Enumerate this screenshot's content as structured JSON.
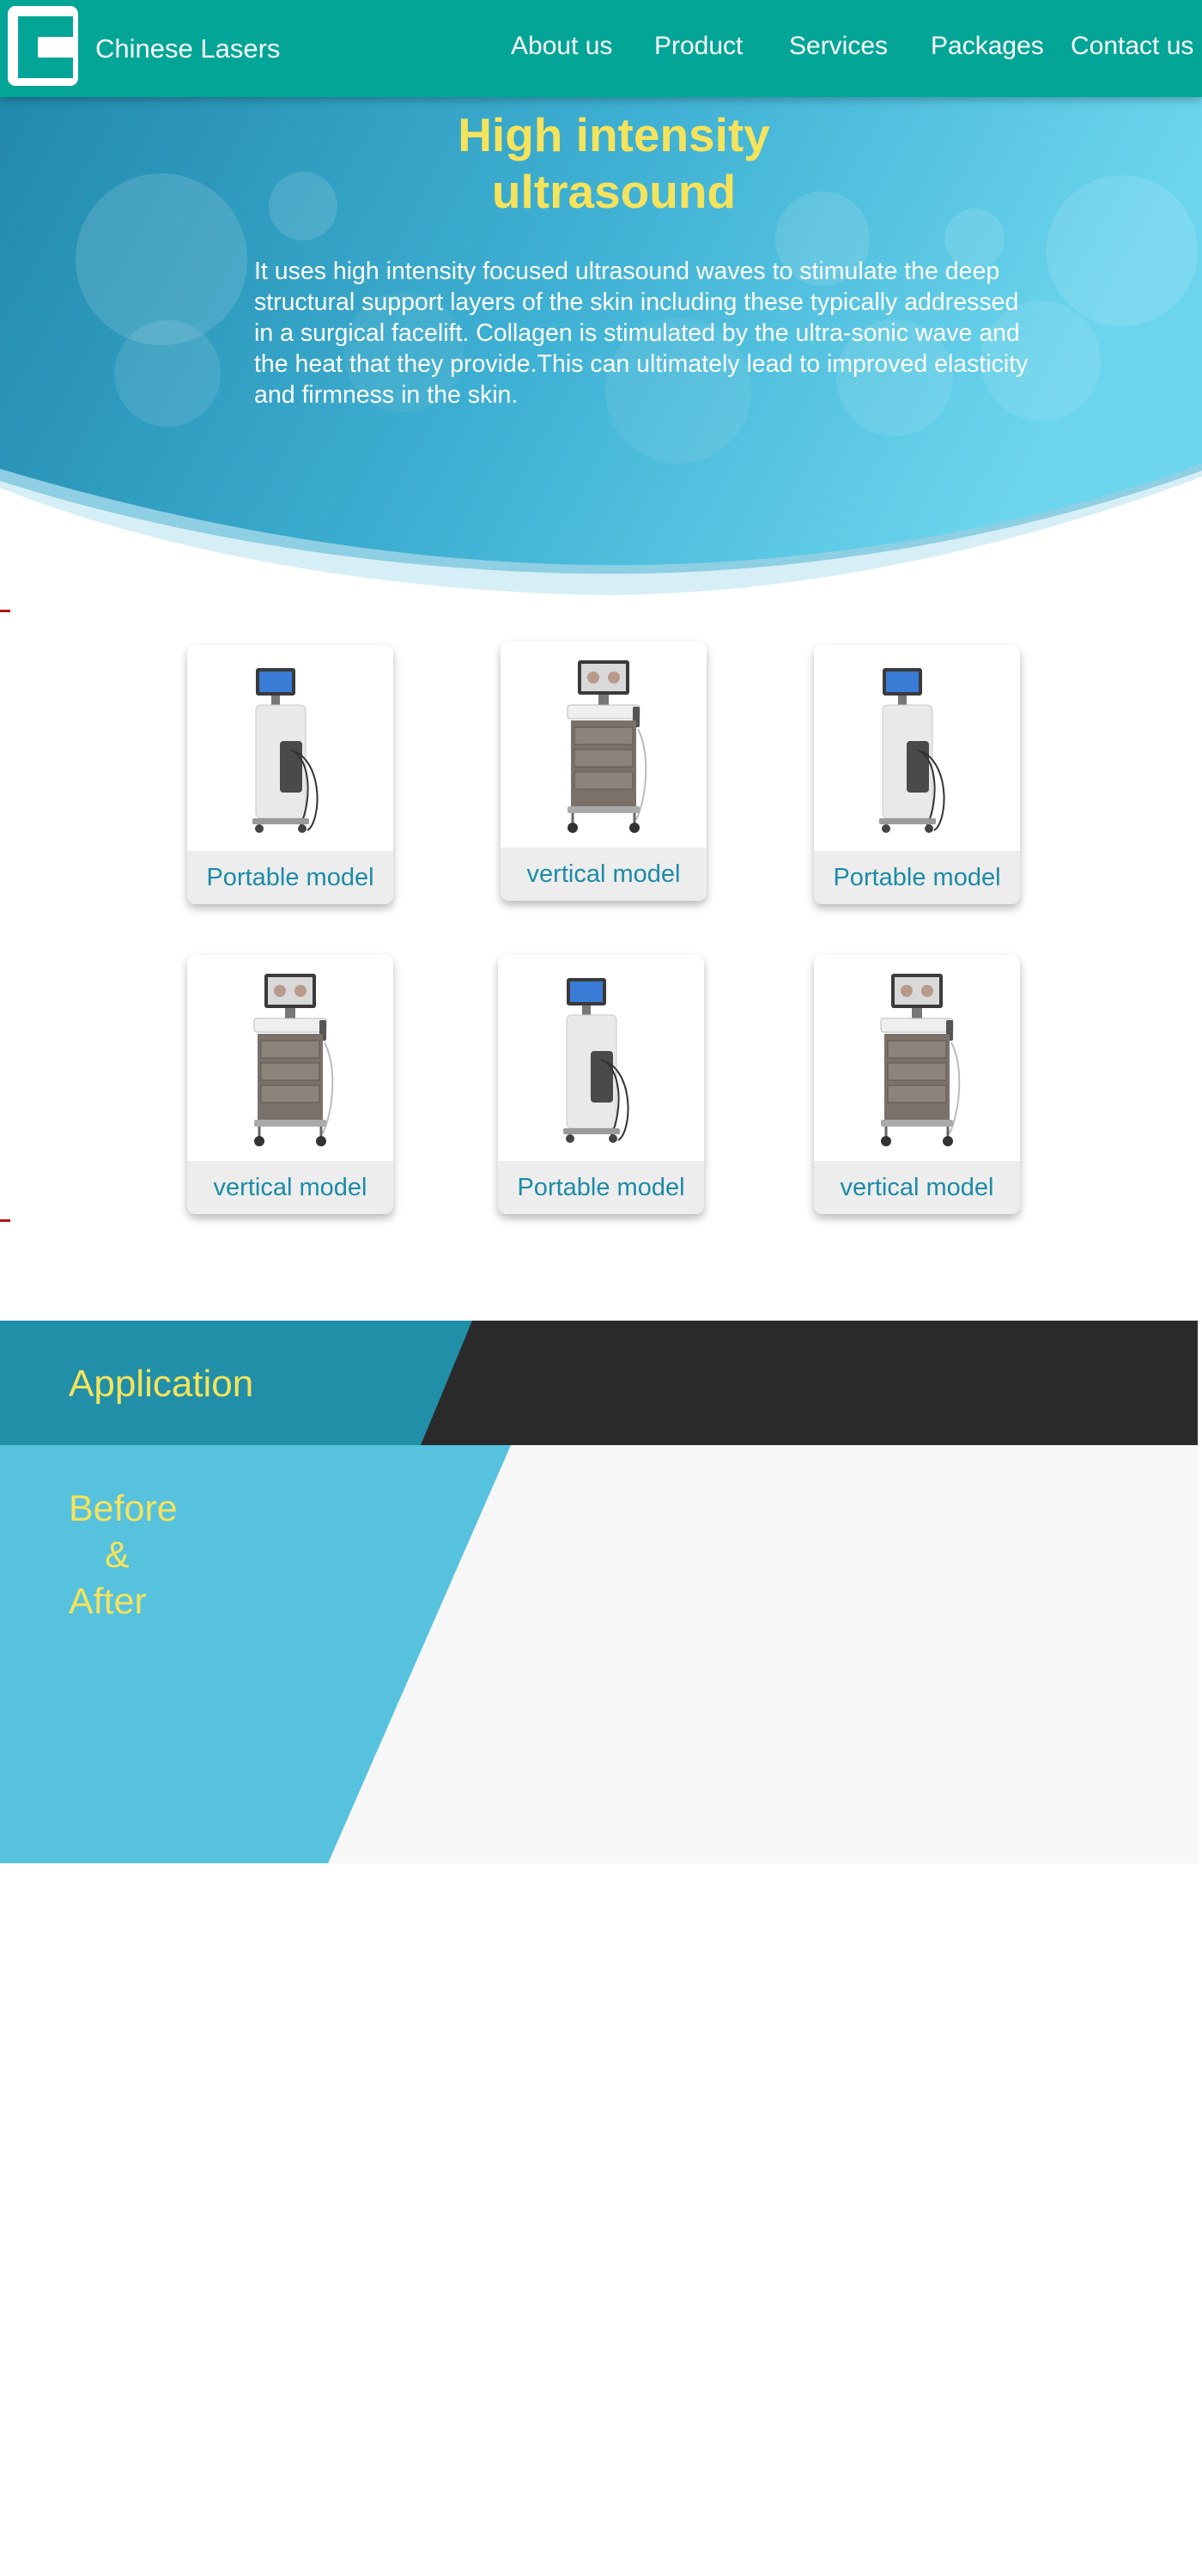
{
  "header": {
    "site_title": "Chinese Lasers",
    "nav": [
      "About us",
      "Product",
      "Services",
      "Packages",
      "Contact us"
    ]
  },
  "hero": {
    "title": "High intensity\nultrasound",
    "body": "It uses high intensity focused ultrasound waves to stimulate the deep structural support layers of the skin including these typically addressed in a surgical facelift. Collagen is stimulated by the ultra-sonic wave and the heat that they provide.This can ultimately lead to improved elasticity and firmness in the skin."
  },
  "products": [
    {
      "label": "Portable model",
      "kind": "portable"
    },
    {
      "label": "vertical model",
      "kind": "vertical"
    },
    {
      "label": "Portable model",
      "kind": "portable"
    },
    {
      "label": "vertical model",
      "kind": "vertical"
    },
    {
      "label": "Portable model",
      "kind": "portable"
    },
    {
      "label": "vertical model",
      "kind": "vertical"
    }
  ],
  "application": {
    "title": "Application",
    "before_after": [
      "Before",
      "&",
      "After"
    ]
  },
  "colors": {
    "header_bg": "#03a597",
    "accent_yellow": "#f5e35c",
    "label_teal": "#1c8ba6",
    "hero_blue_dark": "#2389ab",
    "hero_blue_light": "#69d3ec",
    "app_teal": "#218fa8",
    "app_dark": "#2a2a2b",
    "app_light_blue": "#56c2de"
  }
}
